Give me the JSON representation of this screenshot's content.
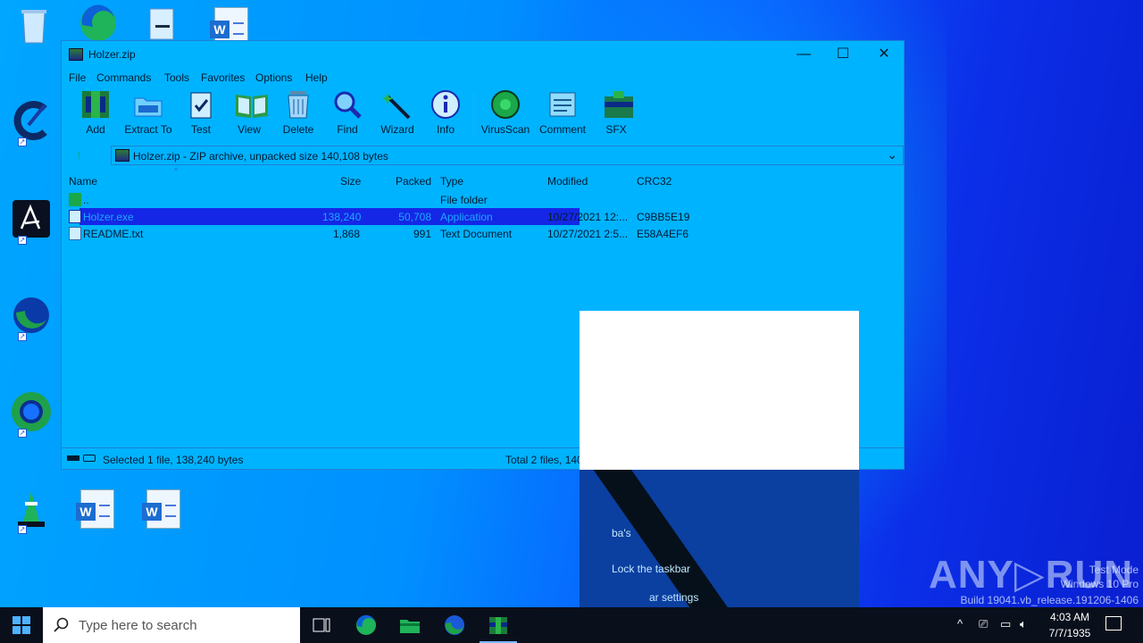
{
  "window": {
    "title": "Holzer.zip",
    "minimize": "—",
    "maximize": "☐",
    "close": "✕"
  },
  "menu": [
    "File",
    "Commands",
    "Tools",
    "Favorites",
    "Options",
    "Help"
  ],
  "toolbar": [
    "Add",
    "Extract To",
    "Test",
    "View",
    "Delete",
    "Find",
    "Wizard",
    "Info",
    "VirusScan",
    "Comment",
    "SFX"
  ],
  "address": {
    "text": "Holzer.zip - ZIP archive, unpacked size 140,108 bytes",
    "dropdown": "⌄"
  },
  "columns": {
    "name": "Name",
    "size": "Size",
    "packed": "Packed",
    "type": "Type",
    "modified": "Modified",
    "crc": "CRC32"
  },
  "files": [
    {
      "name": "..",
      "size": "",
      "packed": "",
      "type": "File folder",
      "modified": "",
      "crc": ""
    },
    {
      "name": "Holzer.exe",
      "size": "138,240",
      "packed": "50,708",
      "type": "Application",
      "modified": "10/27/2021 12:...",
      "crc": "C9BB5E19"
    },
    {
      "name": "README.txt",
      "size": "1,868",
      "packed": "991",
      "type": "Text Document",
      "modified": "10/27/2021 2:5...",
      "crc": "E58A4EF6"
    }
  ],
  "status": {
    "left": "Selected 1 file, 138,240 bytes",
    "right": "Total 2 files, 140,108 bytes"
  },
  "context_menu": {
    "item1": "ba's",
    "item2": "Lock the taskbar",
    "item3": "ar settings"
  },
  "watermark": {
    "brand": "ANY▷RUN",
    "line1": "Test Mode",
    "line2": "Windows 10 Pro",
    "line3": "Build 19041.vb_release.191206-1406"
  },
  "taskbar": {
    "search_placeholder": "Type here to search",
    "time": "4:03 AM",
    "date": "7/7/1935"
  },
  "colors": {
    "desktop": "#0090ff",
    "window": "#00b3ff",
    "selection": "#1527e6",
    "taskbar": "#0a0f1c"
  }
}
